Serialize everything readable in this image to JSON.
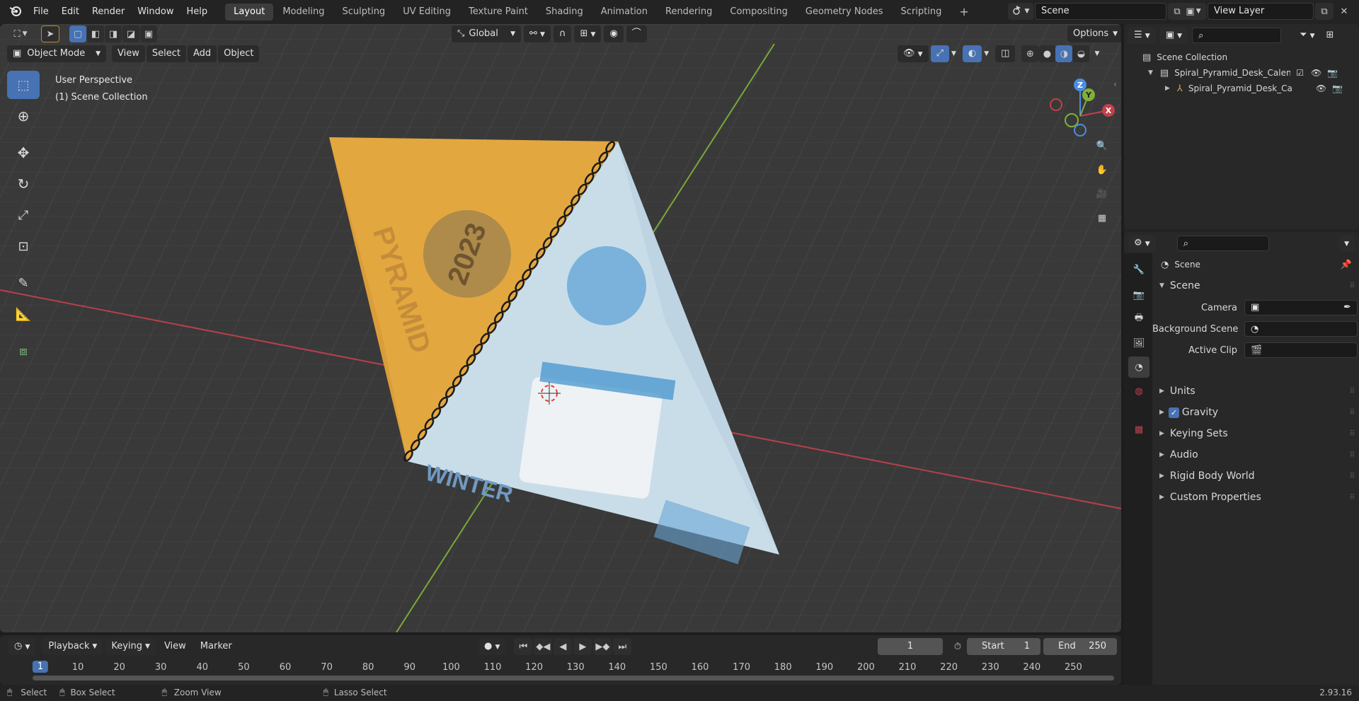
{
  "menu": [
    "File",
    "Edit",
    "Render",
    "Window",
    "Help"
  ],
  "workspaces": [
    "Layout",
    "Modeling",
    "Sculpting",
    "UV Editing",
    "Texture Paint",
    "Shading",
    "Animation",
    "Rendering",
    "Compositing",
    "Geometry Nodes",
    "Scripting"
  ],
  "scene_field": "Scene",
  "view_layer_field": "View Layer",
  "viewport": {
    "mode": "Object Mode",
    "menus": [
      "View",
      "Select",
      "Add",
      "Object"
    ],
    "transform": "Global",
    "options": "Options",
    "overlay_line1": "User Perspective",
    "overlay_line2": "(1) Scene Collection",
    "gizmo": {
      "x": "X",
      "y": "Y",
      "z": "Z"
    },
    "calendar_text": {
      "left": "PYRAMID",
      "year": "2023",
      "bottom": "WINTER"
    }
  },
  "outliner": {
    "root": "Scene Collection",
    "items": [
      "Spiral_Pyramid_Desk_Calenda",
      "Spiral_Pyramid_Desk_Ca"
    ]
  },
  "properties": {
    "header": "Scene",
    "section": "Scene",
    "fields": [
      {
        "label": "Camera"
      },
      {
        "label": "Background Scene"
      },
      {
        "label": "Active Clip"
      }
    ],
    "panels": [
      "Units",
      "Gravity",
      "Keying Sets",
      "Audio",
      "Rigid Body World",
      "Custom Properties"
    ]
  },
  "timeline": {
    "menus": [
      "Playback",
      "Keying",
      "View",
      "Marker"
    ],
    "current_frame": "1",
    "start_label": "Start",
    "start": "1",
    "end_label": "End",
    "end": "250",
    "ticks": [
      "1",
      "10",
      "20",
      "30",
      "40",
      "50",
      "60",
      "70",
      "80",
      "90",
      "100",
      "110",
      "120",
      "130",
      "140",
      "150",
      "160",
      "170",
      "180",
      "190",
      "200",
      "210",
      "220",
      "230",
      "240",
      "250"
    ]
  },
  "status": {
    "select": "Select",
    "box_select": "Box Select",
    "zoom_view": "Zoom View",
    "lasso_select": "Lasso Select",
    "version": "2.93.16"
  },
  "colors": {
    "accent": "#4772b3",
    "x_axis": "#c2404c",
    "y_axis": "#7fb03a",
    "z_axis": "#4c8de0",
    "calendar_orange": "#e3a73f",
    "calendar_blue": "#c9dde9"
  }
}
